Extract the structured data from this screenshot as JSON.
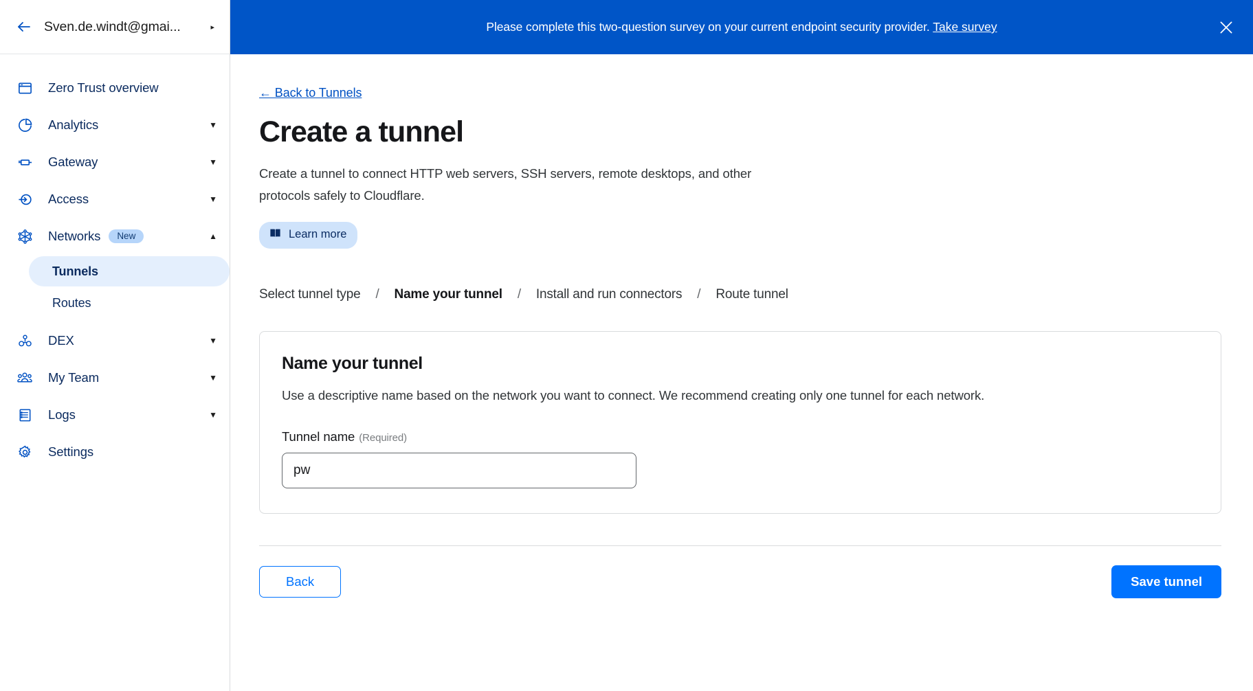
{
  "sidebar": {
    "account": {
      "back_icon": "arrow-left-icon",
      "name": "Sven.de.windt@gmai...",
      "caret": "▸"
    },
    "items": [
      {
        "label": "Zero Trust overview",
        "icon": "browser-window-icon",
        "expandable": false,
        "badge": null
      },
      {
        "label": "Analytics",
        "icon": "pie-chart-icon",
        "expandable": true,
        "badge": null
      },
      {
        "label": "Gateway",
        "icon": "gateway-icon",
        "expandable": true,
        "badge": null
      },
      {
        "label": "Access",
        "icon": "access-arrow-icon",
        "expandable": true,
        "badge": null
      },
      {
        "label": "Networks",
        "icon": "networks-graph-icon",
        "expandable": true,
        "badge": "New",
        "expanded": true
      },
      {
        "label": "DEX",
        "icon": "dex-nodes-icon",
        "expandable": true,
        "badge": null
      },
      {
        "label": "My Team",
        "icon": "people-icon",
        "expandable": true,
        "badge": null
      },
      {
        "label": "Logs",
        "icon": "logs-list-icon",
        "expandable": true,
        "badge": null
      },
      {
        "label": "Settings",
        "icon": "gear-icon",
        "expandable": false,
        "badge": null
      }
    ],
    "subitems": [
      {
        "label": "Tunnels",
        "active": true
      },
      {
        "label": "Routes",
        "active": false
      }
    ],
    "caret_down": "▼",
    "caret_up": "▲"
  },
  "banner": {
    "text": "Please complete this two-question survey on your current endpoint security provider.",
    "link": "Take survey",
    "close_icon": "close-icon",
    "bg_color": "#0055c7"
  },
  "main": {
    "back_link": "← Back to Tunnels",
    "title": "Create a tunnel",
    "description": "Create a tunnel to connect HTTP web servers, SSH servers, remote desktops, and other protocols safely to Cloudflare.",
    "learn_more": {
      "label": "Learn more",
      "icon": "book-icon"
    },
    "steps": [
      {
        "label": "Select tunnel type",
        "current": false
      },
      {
        "label": "Name your tunnel",
        "current": true
      },
      {
        "label": "Install and run connectors",
        "current": false
      },
      {
        "label": "Route tunnel",
        "current": false
      }
    ],
    "step_separator": "/",
    "card": {
      "title": "Name your tunnel",
      "description": "Use a descriptive name based on the network you want to connect. We recommend creating only one tunnel for each network.",
      "field": {
        "label": "Tunnel name",
        "required_hint": "(Required)",
        "value": "pw",
        "placeholder": ""
      }
    },
    "actions": {
      "back": "Back",
      "save": "Save tunnel"
    }
  },
  "colors": {
    "accent_blue": "#0073ff",
    "banner_blue": "#0055c7",
    "nav_blue": "#0051c3",
    "nav_text": "#0a2a5e",
    "badge_bg": "#b6d5fa",
    "active_bg": "#e4effd"
  }
}
